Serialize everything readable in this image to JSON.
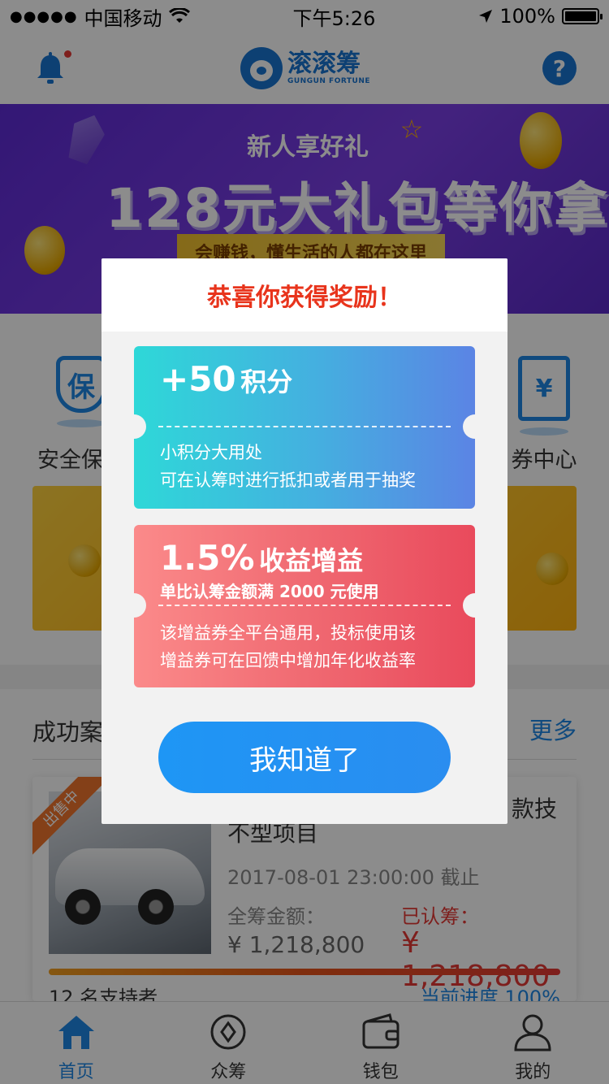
{
  "status_bar": {
    "carrier": "中国移动",
    "time": "下午5:26",
    "battery": "100%"
  },
  "nav": {
    "logo_cn": "滚滚筹",
    "logo_en": "GUNGUN FORTUNE",
    "help_label": "?"
  },
  "banner": {
    "subtitle": "新人享好礼",
    "title": "128元大礼包等你拿",
    "ribbon": "会赚钱，懂生活的人都在这里"
  },
  "quick_entries": {
    "items": [
      {
        "label": "安全保障",
        "icon": "shield-icon",
        "glyph": "保"
      },
      {
        "label": "券中心",
        "icon": "ticket-icon",
        "glyph": "¥"
      }
    ]
  },
  "cases": {
    "title": "成功案例",
    "more": "更多",
    "card": {
      "badge": "出售中",
      "name": "不型项目",
      "name_tail": "款技",
      "deadline": "2017-08-01  23:00:00 截止",
      "total_label": "全筹金额：",
      "total_value": "¥ 1,218,800",
      "raised_label": "已认筹：",
      "raised_value": "¥ 1,218,800",
      "progress": 1.0,
      "supporters": "12 名支持者",
      "progress_text": "当前进度 100%"
    }
  },
  "tabs": [
    {
      "label": "首页",
      "icon": "home-icon"
    },
    {
      "label": "众筹",
      "icon": "crowdfund-icon"
    },
    {
      "label": "钱包",
      "icon": "wallet-icon"
    },
    {
      "label": "我的",
      "icon": "profile-icon"
    }
  ],
  "modal": {
    "title": "恭喜你获得奖励！",
    "coupon_points": {
      "amount": "+50",
      "unit": "积分",
      "desc_1": "小积分大用处",
      "desc_2": "可在认筹时进行抵扣或者用于抽奖"
    },
    "coupon_yield": {
      "amount": "1.5%",
      "unit": "收益增益",
      "condition": "单比认筹金额满 2000 元使用",
      "desc_1": "该增益券全平台通用，投标使用该",
      "desc_2": "增益券可在回馈中增加年化收益率"
    },
    "confirm_button": "我知道了"
  },
  "colors": {
    "accent_blue": "#1e88e5",
    "title_red": "#e8341c",
    "coupon_teal_start": "#2ed8d8",
    "coupon_blue_end": "#5b84e4",
    "coupon_pink_start": "#fb8a8a",
    "coupon_red_end": "#e94a5c"
  }
}
